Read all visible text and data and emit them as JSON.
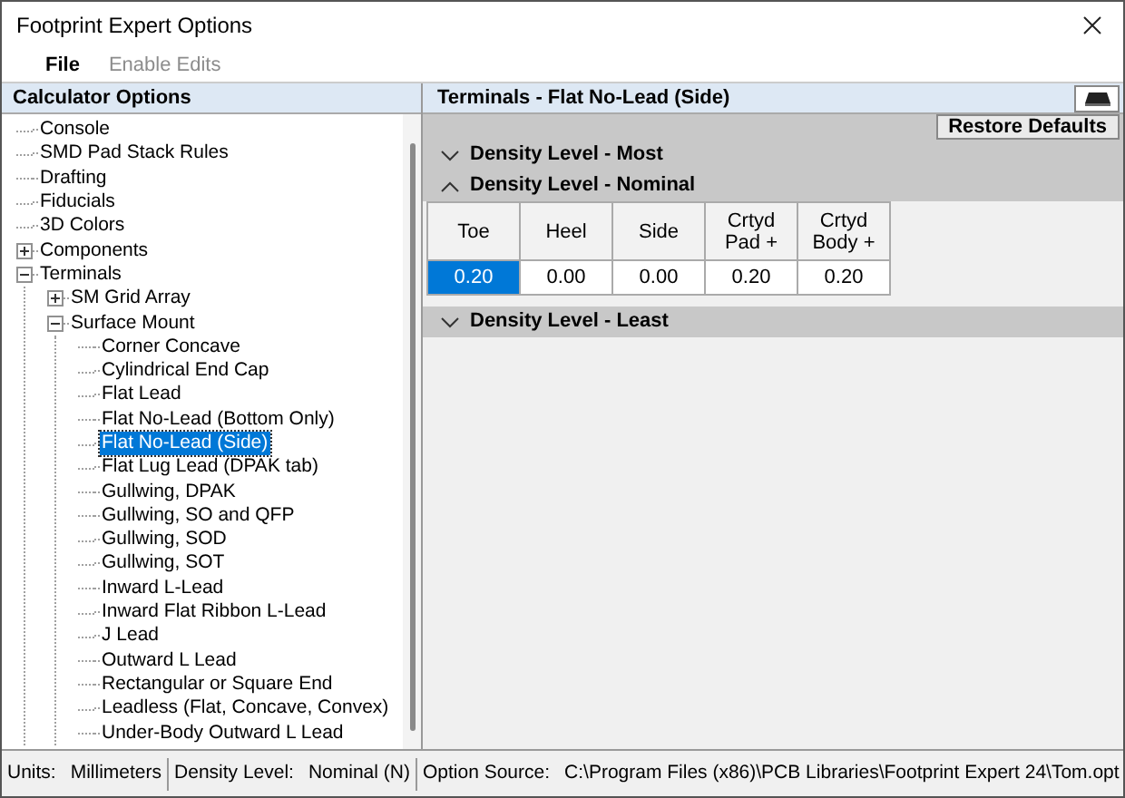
{
  "window": {
    "title": "Footprint Expert Options"
  },
  "menu": [
    {
      "label": "File",
      "disabled": false
    },
    {
      "label": "Enable Edits",
      "disabled": true
    }
  ],
  "sidebar": {
    "title": "Calculator Options",
    "tree": [
      {
        "label": "Console",
        "selected": false
      },
      {
        "label": "SMD Pad Stack Rules",
        "selected": false
      },
      {
        "label": "Drafting",
        "selected": false
      },
      {
        "label": "Fiducials",
        "selected": false
      },
      {
        "label": "3D Colors",
        "selected": false
      },
      {
        "label": "Components",
        "selected": false,
        "expanded": false
      },
      {
        "label": "Terminals",
        "selected": false,
        "expanded": true,
        "children": [
          {
            "label": "SM Grid Array",
            "selected": false,
            "expanded": false
          },
          {
            "label": "Surface Mount",
            "selected": false,
            "expanded": true,
            "children": [
              {
                "label": "Corner Concave",
                "selected": false
              },
              {
                "label": "Cylindrical End Cap",
                "selected": false
              },
              {
                "label": "Flat Lead",
                "selected": false
              },
              {
                "label": "Flat No-Lead (Bottom Only)",
                "selected": false
              },
              {
                "label": "Flat No-Lead (Side)",
                "selected": true
              },
              {
                "label": "Flat Lug Lead (DPAK tab)",
                "selected": false
              },
              {
                "label": "Gullwing, DPAK",
                "selected": false
              },
              {
                "label": "Gullwing, SO and QFP",
                "selected": false
              },
              {
                "label": "Gullwing, SOD",
                "selected": false
              },
              {
                "label": "Gullwing, SOT",
                "selected": false
              },
              {
                "label": "Inward L-Lead",
                "selected": false
              },
              {
                "label": "Inward Flat Ribbon L-Lead",
                "selected": false
              },
              {
                "label": "J Lead",
                "selected": false
              },
              {
                "label": "Outward L Lead",
                "selected": false
              },
              {
                "label": "Rectangular or Square End",
                "selected": false
              },
              {
                "label": "Leadless (Flat, Concave, Convex)",
                "selected": false
              },
              {
                "label": "Under-Body Outward L Lead",
                "selected": false
              }
            ]
          }
        ]
      }
    ]
  },
  "panel": {
    "title": "Terminals - Flat No-Lead (Side)",
    "restore_button": "Restore Defaults",
    "sections": [
      {
        "title": "Density Level - Most",
        "expanded": false
      },
      {
        "title": "Density Level - Nominal",
        "expanded": true,
        "columns": [
          "Toe",
          "Heel",
          "Side",
          "Crtyd\nPad +",
          "Crtyd\nBody +"
        ],
        "cells": [
          {
            "value": "0.20",
            "selected": true
          },
          {
            "value": "0.00",
            "selected": false
          },
          {
            "value": "0.00",
            "selected": false
          },
          {
            "value": "0.20",
            "selected": false
          },
          {
            "value": "0.20",
            "selected": false
          }
        ]
      },
      {
        "title": "Density Level - Least",
        "expanded": false
      }
    ]
  },
  "status_bar": [
    {
      "label": "Units:",
      "value": "Millimeters"
    },
    {
      "label": "Density Level:",
      "value": "Nominal (N)"
    },
    {
      "label": "Option Source:",
      "value": "C:\\Program Files (x86)\\PCB Libraries\\Footprint Expert 24\\Tom.opt"
    }
  ]
}
